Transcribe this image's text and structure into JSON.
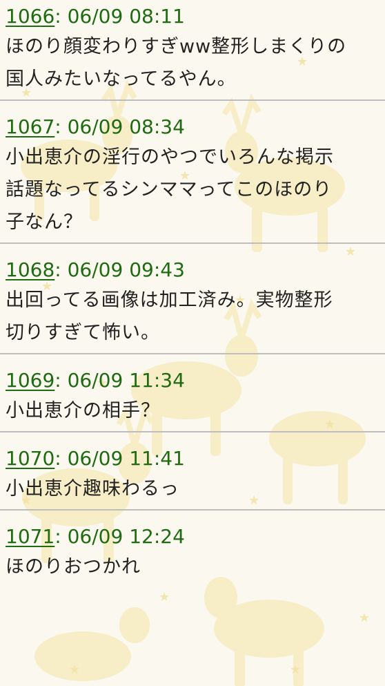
{
  "posts": [
    {
      "number": "1066",
      "datetime": "06/09 08:11",
      "lines": [
        "ほのり顔変わりすぎww整形しまくりの",
        "国人みたいなってるやん。"
      ]
    },
    {
      "number": "1067",
      "datetime": "06/09 08:34",
      "lines": [
        "小出恵介の淫行のやつでいろんな掲示",
        "話題なってるシンママってこのほのり",
        "子なん？"
      ]
    },
    {
      "number": "1068",
      "datetime": "06/09 09:43",
      "lines": [
        "出回ってる画像は加工済み。実物整形",
        "切りすぎて怖い。"
      ]
    },
    {
      "number": "1069",
      "datetime": "06/09 11:34",
      "lines": [
        "小出恵介の相手？"
      ]
    },
    {
      "number": "1070",
      "datetime": "06/09 11:41",
      "lines": [
        "小出恵介趣味わるっ"
      ]
    },
    {
      "number": "1071",
      "datetime": "06/09 12:24",
      "lines": [
        "ほのりおつかれ"
      ]
    }
  ],
  "separator": ": ",
  "colors": {
    "header": "#1e6b12",
    "body_text": "#222222",
    "divider": "#bdbdbd",
    "background": "#fbf8ef",
    "pattern": "#f5e9b8"
  }
}
